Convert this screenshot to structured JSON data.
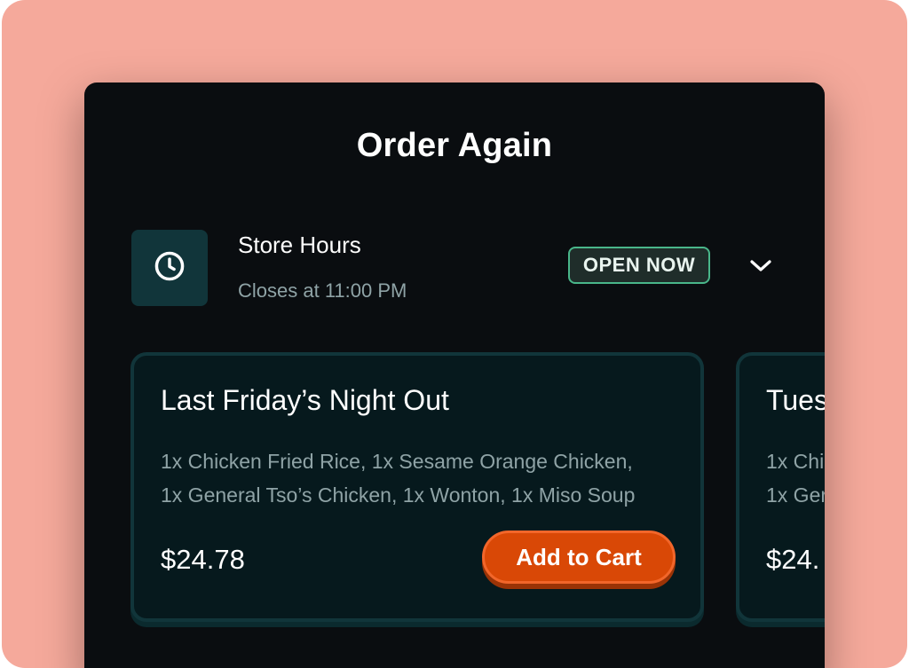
{
  "header": {
    "title": "Order Again"
  },
  "store_hours": {
    "icon": "clock-icon",
    "title": "Store Hours",
    "subtitle": "Closes at 11:00 PM",
    "status_badge": "OPEN NOW",
    "expand_icon": "chevron-down-icon"
  },
  "orders": [
    {
      "title": "Last Friday’s Night Out",
      "items_line_1": "1x Chicken Fried Rice, 1x Sesame Orange Chicken,",
      "items_line_2": "1x General Tso’s Chicken, 1x Wonton, 1x Miso Soup",
      "price": "$24.78",
      "button_label": "Add to Cart"
    },
    {
      "title": "Tues",
      "items_line_1": "1x Chi",
      "items_line_2": "1x Ger",
      "price": "$24."
    }
  ],
  "colors": {
    "backdrop": "#f5a99b",
    "panel": "#0a0d10",
    "card": "#06191d",
    "card_border": "#11353a",
    "accent_button": "#d94806",
    "badge_border": "#49b68a",
    "muted_text": "#8fa3a6"
  }
}
